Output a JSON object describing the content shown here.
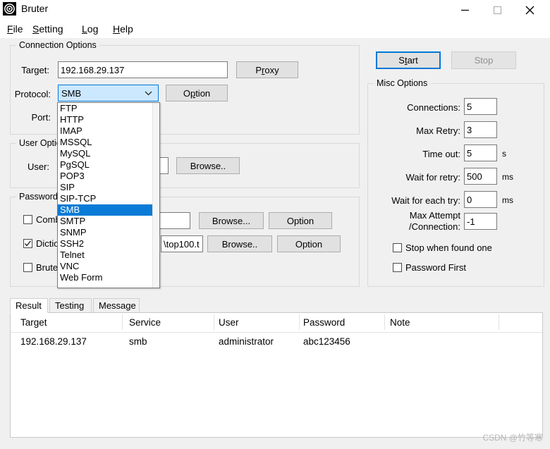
{
  "window": {
    "title": "Bruter",
    "icon": "target-icon",
    "controls": {
      "minimize": "minimize-icon",
      "maximize": "maximize-icon",
      "close": "close-icon"
    }
  },
  "menubar": {
    "items": [
      {
        "label": "File",
        "accel": "F"
      },
      {
        "label": "Setting",
        "accel": "S"
      },
      {
        "label": "Log",
        "accel": "L"
      },
      {
        "label": "Help",
        "accel": "H"
      }
    ]
  },
  "connection_options": {
    "title": "Connection Options",
    "target_label": "Target:",
    "target_value": "192.168.29.137",
    "proxy_button": "Proxy",
    "protocol_label": "Protocol:",
    "protocol_value": "SMB",
    "option_button": "Option",
    "port_label": "Port:",
    "port_value": ""
  },
  "protocol_dropdown": {
    "open": true,
    "selected": "SMB",
    "items": [
      "FTP",
      "HTTP",
      "IMAP",
      "MSSQL",
      "MySQL",
      "PgSQL",
      "POP3",
      "SIP",
      "SIP-TCP",
      "SMB",
      "SMTP",
      "SNMP",
      "SSH2",
      "Telnet",
      "VNC",
      "Web Form"
    ]
  },
  "user_options": {
    "title": "User Options",
    "user_label": "User:",
    "user_value_visible": "xt",
    "browse_button": "Browse.."
  },
  "password_options": {
    "title": "Password",
    "combo_label": "Comb",
    "combo_checked": false,
    "combo_value": "",
    "combo_browse_button": "Browse...",
    "combo_option_button": "Option",
    "dictionary_label": "Dictio",
    "dictionary_checked": true,
    "dictionary_value_visible": "\\top100.t",
    "dictionary_browse_button": "Browse..",
    "dictionary_option_button": "Option",
    "brute_label": "Brute"
  },
  "actions": {
    "start_button": "Start",
    "start_accel": "t",
    "stop_button": "Stop",
    "stop_disabled": true
  },
  "misc_options": {
    "title": "Misc Options",
    "fields": [
      {
        "label": "Connections:",
        "value": "5",
        "unit": ""
      },
      {
        "label": "Max Retry:",
        "value": "3",
        "unit": ""
      },
      {
        "label": "Time out:",
        "value": "5",
        "unit": "s"
      },
      {
        "label": "Wait for retry:",
        "value": "500",
        "unit": "ms"
      },
      {
        "label": "Wait for each try:",
        "value": "0",
        "unit": "ms"
      }
    ],
    "max_attempt_label_line1": "Max Attempt",
    "max_attempt_label_line2": "/Connection:",
    "max_attempt_value": "-1",
    "stop_when_found_label": "Stop when found one",
    "stop_when_found_checked": false,
    "password_first_label": "Password First",
    "password_first_checked": false
  },
  "tabs": [
    {
      "label": "Result",
      "active": true
    },
    {
      "label": "Testing",
      "active": false
    },
    {
      "label": "Message",
      "active": false
    }
  ],
  "result_table": {
    "columns": [
      "Target",
      "Service",
      "User",
      "Password",
      "Note"
    ],
    "rows": [
      {
        "target": "192.168.29.137",
        "service": "smb",
        "user": "administrator",
        "password": "abc123456",
        "note": ""
      }
    ]
  },
  "watermark": "CSDN @竹等寒",
  "colors": {
    "accent": "#0078d7",
    "selection": "#0a7bd6",
    "combo_bg": "#cce8ff",
    "window_bg": "#f0f0f0",
    "disabled_text": "#909090"
  }
}
